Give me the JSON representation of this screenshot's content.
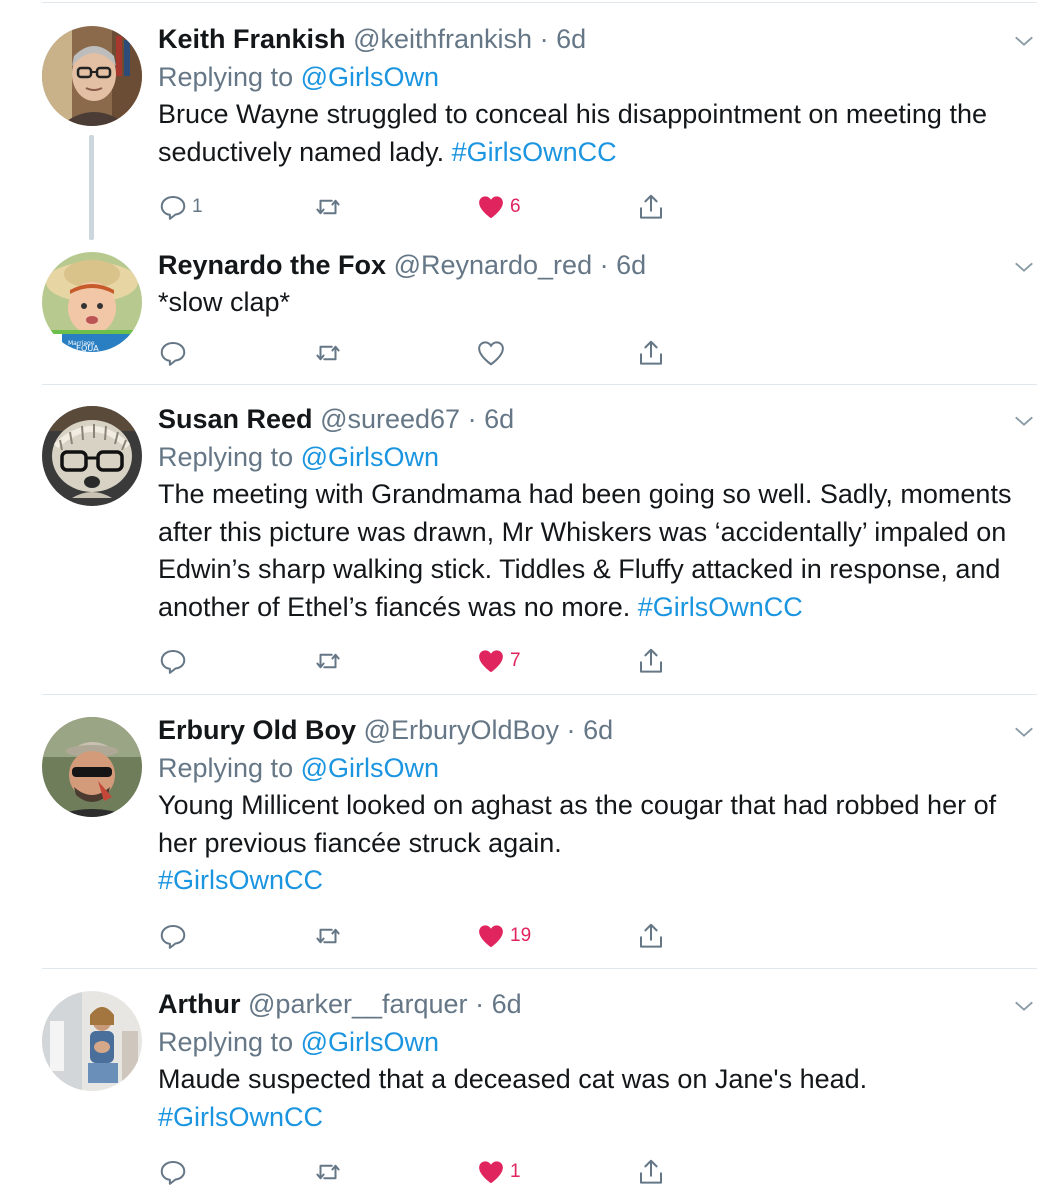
{
  "tweets": [
    {
      "name": "Keith Frankish",
      "handle": "@keithfrankish",
      "separator": "·",
      "time": "6d",
      "replying_label": "Replying to",
      "replying_to": "@GirlsOwn",
      "lines": [
        "Bruce Wayne struggled to conceal his disappointment on meeting the",
        "seductively named lady. "
      ],
      "hashtag": "#GirlsOwnCC",
      "reply_count": "1",
      "retweet_count": "",
      "like_count": "6",
      "liked": true
    },
    {
      "name": "Reynardo the Fox",
      "handle": "@Reynardo_red",
      "separator": "·",
      "time": "6d",
      "avatar_badge": "Marriage EQUA",
      "lines": [
        "*slow clap*"
      ],
      "reply_count": "",
      "retweet_count": "",
      "like_count": "",
      "liked": false
    },
    {
      "name": "Susan Reed",
      "handle": "@sureed67",
      "separator": "·",
      "time": "6d",
      "replying_label": "Replying to",
      "replying_to": "@GirlsOwn",
      "lines": [
        "The meeting with Grandmama had been going so well. Sadly, moments",
        "after this picture was drawn, Mr Whiskers was ‘accidentally’ impaled on",
        "Edwin’s sharp walking stick. Tiddles & Fluffy attacked in response, and",
        "another of Ethel’s fiancés was no more. "
      ],
      "hashtag": "#GirlsOwnCC",
      "reply_count": "",
      "retweet_count": "",
      "like_count": "7",
      "liked": true
    },
    {
      "name": "Erbury Old Boy",
      "handle": "@ErburyOldBoy",
      "separator": "·",
      "time": "6d",
      "replying_label": "Replying to",
      "replying_to": "@GirlsOwn",
      "lines": [
        "Young Millicent looked on aghast as the cougar that had robbed her of",
        "her previous fiancée struck again."
      ],
      "hashtag": "#GirlsOwnCC",
      "reply_count": "",
      "retweet_count": "",
      "like_count": "19",
      "liked": true
    },
    {
      "name": "Arthur",
      "handle": "@parker__farquer",
      "separator": "·",
      "time": "6d",
      "replying_label": "Replying to",
      "replying_to": "@GirlsOwn",
      "lines": [
        "Maude suspected that a deceased cat was on Jane's head."
      ],
      "hashtag": "#GirlsOwnCC",
      "reply_count": "",
      "retweet_count": "",
      "like_count": "1",
      "liked": true
    }
  ],
  "colors": {
    "link": "#1b95e0",
    "like": "#e0245e",
    "muted": "#657786",
    "divider": "#e1e8ed"
  },
  "icons": {
    "reply": "reply-icon",
    "retweet": "retweet-icon",
    "like": "heart-icon",
    "share": "share-icon",
    "more": "chevron-down-icon"
  }
}
